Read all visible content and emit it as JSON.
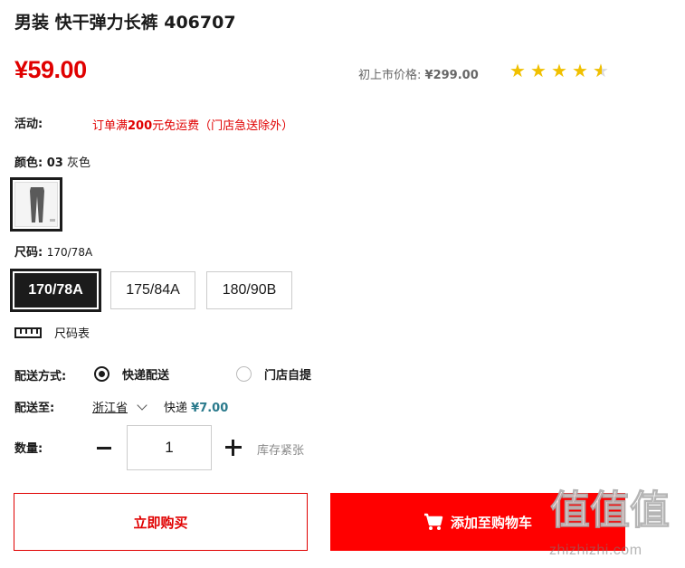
{
  "product": {
    "title": "男装 快干弹力长裤 406707",
    "price": "¥59.00",
    "original_price_label": "初上市价格:",
    "original_price": "¥299.00",
    "rating_stars": 4.5,
    "colors": {
      "star": "#f0c000",
      "price": "#e00000",
      "fee": "#2a7a8c"
    }
  },
  "promo": {
    "label": "活动:",
    "text_before": "订单满",
    "text_amount": "200",
    "text_after": "元免运费（门店急送除外）"
  },
  "color": {
    "label": "颜色:",
    "code": "03",
    "name": "灰色"
  },
  "size": {
    "label": "尺码:",
    "selected": "170/78A",
    "options": [
      "170/78A",
      "175/84A",
      "180/90B"
    ]
  },
  "size_chart": {
    "label": "尺码表"
  },
  "delivery": {
    "label": "配送方式:",
    "options": [
      "快递配送",
      "门店自提"
    ],
    "selected": "快递配送"
  },
  "ship_to": {
    "label": "配送至:",
    "region": "浙江省",
    "method": "快递",
    "fee": "¥7.00"
  },
  "quantity": {
    "label": "数量:",
    "value": "1",
    "stock_note": "库存紧张"
  },
  "actions": {
    "buy_now": "立即购买",
    "add_to_cart": "添加至购物车"
  },
  "watermark": {
    "glyphs": "值值值",
    "url": "zhizhizhi.com"
  }
}
